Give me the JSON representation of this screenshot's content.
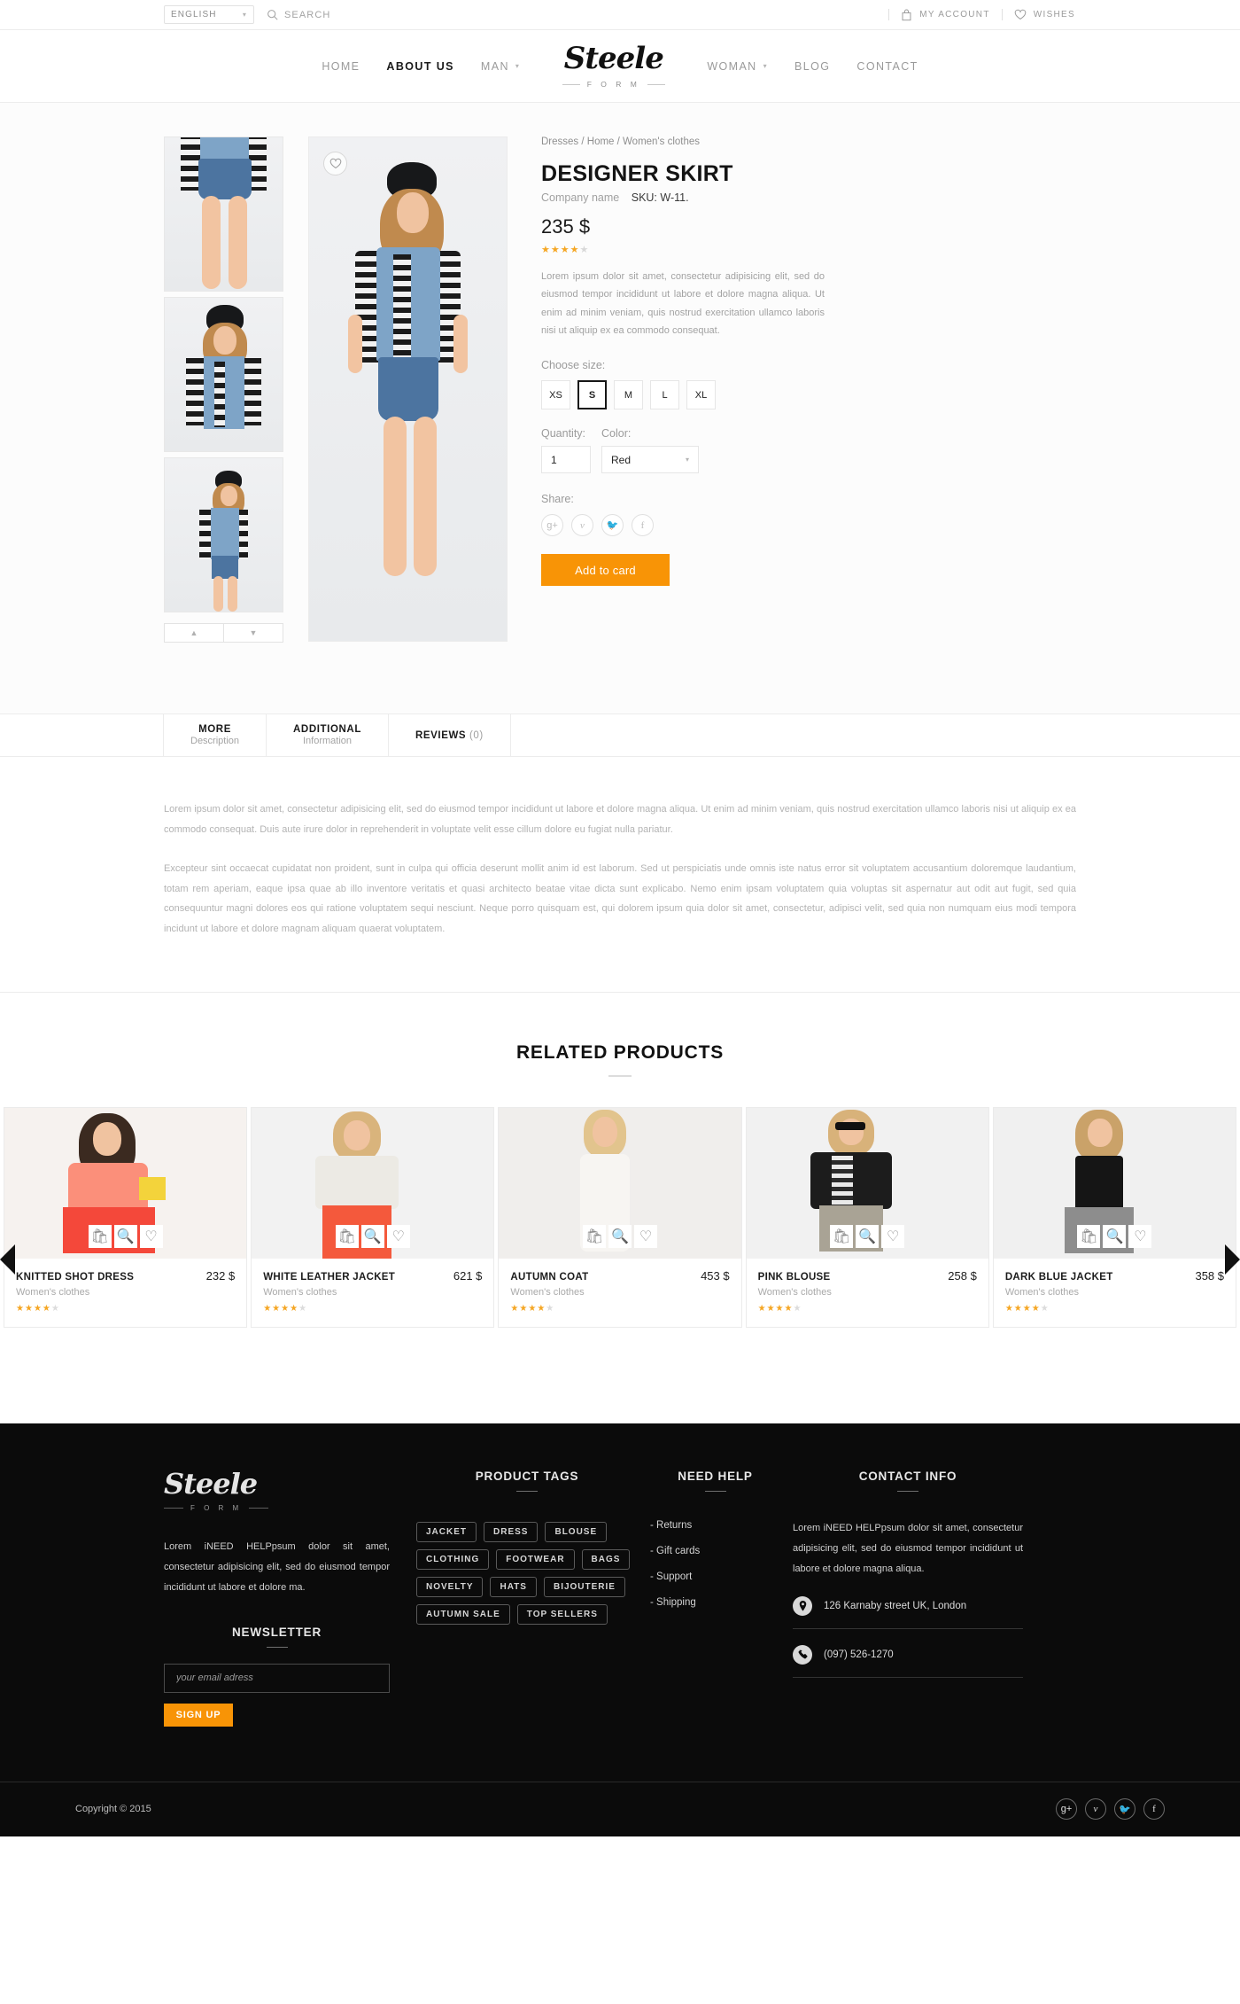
{
  "topbar": {
    "language": "ENGLISH",
    "search_label": "SEARCH",
    "account_label": "MY ACCOUNT",
    "wishes_label": "WISHES"
  },
  "nav": {
    "left_items": [
      {
        "label": "HOME",
        "active": false,
        "has_caret": false
      },
      {
        "label": "ABOUT US",
        "active": true,
        "has_caret": false
      },
      {
        "label": "MAN",
        "active": false,
        "has_caret": true
      }
    ],
    "right_items": [
      {
        "label": "WOMAN",
        "active": false,
        "has_caret": true
      },
      {
        "label": "BLOG",
        "active": false,
        "has_caret": false
      },
      {
        "label": "CONTACT",
        "active": false,
        "has_caret": false
      }
    ],
    "logo_script": "Steele",
    "logo_sub": "F O R M"
  },
  "product": {
    "breadcrumb": "Dresses  /  Home  /  Women's clothes",
    "title": "DESIGNER SKIRT",
    "company": "Company name",
    "sku": "SKU: W-11.",
    "price": "235 $",
    "rating": 4,
    "rating_max": 5,
    "description": "Lorem ipsum dolor sit amet, consectetur adipisicing elit, sed do eiusmod tempor incididunt ut labore et dolore magna aliqua. Ut enim ad minim veniam, quis nostrud exercitation ullamco laboris nisi ut aliquip ex ea commodo consequat.",
    "size_label": "Choose size:",
    "sizes": [
      "XS",
      "S",
      "M",
      "L",
      "XL"
    ],
    "selected_size": "S",
    "quantity_label": "Quantity:",
    "quantity_value": "1",
    "color_label": "Color:",
    "color_value": "Red",
    "share_label": "Share:",
    "share_icons": [
      "google-plus-icon",
      "vimeo-icon",
      "twitter-icon",
      "facebook-icon"
    ],
    "add_to_cart": "Add to card",
    "wishlist_icon": "heart-icon",
    "thumb_up_icon": "chevron-up-icon",
    "thumb_down_icon": "chevron-down-icon"
  },
  "tabs": [
    {
      "line1": "MORE",
      "line2": "Description",
      "count": ""
    },
    {
      "line1": "ADDITIONAL",
      "line2": "Information",
      "count": ""
    },
    {
      "line1": "REVIEWS",
      "line2": "",
      "count": "(0)"
    }
  ],
  "tab_body": {
    "paragraph1": "Lorem ipsum dolor sit amet, consectetur adipisicing elit, sed do eiusmod tempor incididunt ut labore et dolore magna aliqua. Ut enim ad minim veniam, quis nostrud exercitation ullamco laboris nisi ut aliquip ex ea commodo consequat. Duis aute irure dolor in reprehenderit in voluptate velit esse cillum dolore eu fugiat nulla pariatur.",
    "paragraph2": "Excepteur sint occaecat cupidatat non proident, sunt in culpa qui officia deserunt mollit anim id est laborum. Sed ut perspiciatis unde omnis iste natus error sit voluptatem accusantium doloremque laudantium, totam rem aperiam, eaque ipsa quae ab illo inventore veritatis et quasi architecto beatae vitae dicta sunt explicabo. Nemo enim ipsam voluptatem quia voluptas sit aspernatur aut odit aut fugit, sed quia consequuntur magni dolores eos qui ratione voluptatem sequi nesciunt. Neque porro quisquam est, qui dolorem ipsum quia dolor sit amet, consectetur, adipisci velit, sed quia non numquam eius modi tempora incidunt ut labore et dolore magnam aliquam quaerat voluptatem."
  },
  "related": {
    "title": "RELATED PRODUCTS",
    "prev_icon": "arrow-left-icon",
    "next_icon": "arrow-right-icon",
    "hover_icons": [
      "bag-icon",
      "search-icon",
      "heart-icon"
    ],
    "products": [
      {
        "name": "KNITTED SHOT DRESS",
        "price": "232 $",
        "category": "Women's clothes",
        "rating": 4
      },
      {
        "name": "WHITE LEATHER JACKET",
        "price": "621 $",
        "category": "Women's clothes",
        "rating": 4
      },
      {
        "name": "AUTUMN COAT",
        "price": "453 $",
        "category": "Women's clothes",
        "rating": 4
      },
      {
        "name": "PINK BLOUSE",
        "price": "258 $",
        "category": "Women's clothes",
        "rating": 4
      },
      {
        "name": "DARK BLUE JACKET",
        "price": "358 $",
        "category": "Women's clothes",
        "rating": 4
      }
    ]
  },
  "footer": {
    "logo_script": "Steele",
    "logo_sub": "F O R M",
    "about": "Lorem iNEED HELPpsum dolor sit amet, consectetur adipisicing elit, sed do eiusmod tempor incididunt ut labore et dolore ma.",
    "newsletter_title": "NEWSLETTER",
    "newsletter_placeholder": "your email adress",
    "signup_label": "SIGN UP",
    "tags_title": "PRODUCT TAGS",
    "tags": [
      "JACKET",
      "DRESS",
      "BLOUSE",
      "CLOTHING",
      "FOOTWEAR",
      "BAGS",
      "NOVELTY",
      "HATS",
      "BIJOUTERIE",
      "AUTUMN SALE",
      "TOP SELLERS"
    ],
    "help_title": "NEED HELP",
    "help_items": [
      "- Returns",
      "- Gift cards",
      "- Support",
      "- Shipping"
    ],
    "contact_title": "CONTACT INFO",
    "contact_text": "Lorem iNEED HELPpsum dolor sit amet, consectetur adipisicing elit, sed do eiusmod tempor incididunt ut labore et dolore magna aliqua.",
    "address": "126 Karnaby street UK, London",
    "address_icon": "location-pin-icon",
    "phone": "(097) 526-1270",
    "phone_icon": "phone-icon",
    "copyright": "Copyright © 2015",
    "social": [
      "google-plus-icon",
      "vimeo-icon",
      "twitter-icon",
      "facebook-icon"
    ]
  },
  "colors": {
    "accent": "#f89406",
    "star": "#f5a623",
    "footer_bg": "#0b0b0b"
  }
}
